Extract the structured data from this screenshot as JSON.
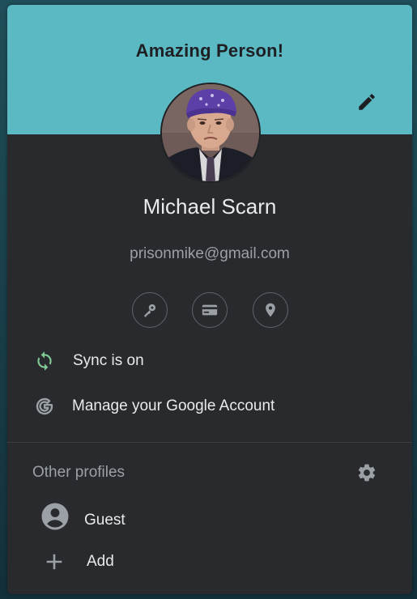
{
  "banner": {
    "title": "Amazing Person!",
    "color": "#5bb9c4",
    "edit_icon": "pencil-icon"
  },
  "profile": {
    "name": "Michael Scarn",
    "email": "prisonmike@gmail.com",
    "avatar_icon": "avatar-photo"
  },
  "quick_actions": [
    {
      "icon": "key-icon"
    },
    {
      "icon": "credit-card-icon"
    },
    {
      "icon": "location-pin-icon"
    }
  ],
  "menu": {
    "sync_label": "Sync is on",
    "sync_icon": "sync-icon",
    "sync_color": "#81c995",
    "manage_label": "Manage your Google Account",
    "manage_icon": "google-g-icon"
  },
  "other_profiles": {
    "label": "Other profiles",
    "settings_icon": "gear-icon",
    "items": [
      {
        "label": "Guest",
        "icon": "account-circle-icon"
      },
      {
        "label": "Add",
        "icon": "plus-icon"
      }
    ]
  }
}
